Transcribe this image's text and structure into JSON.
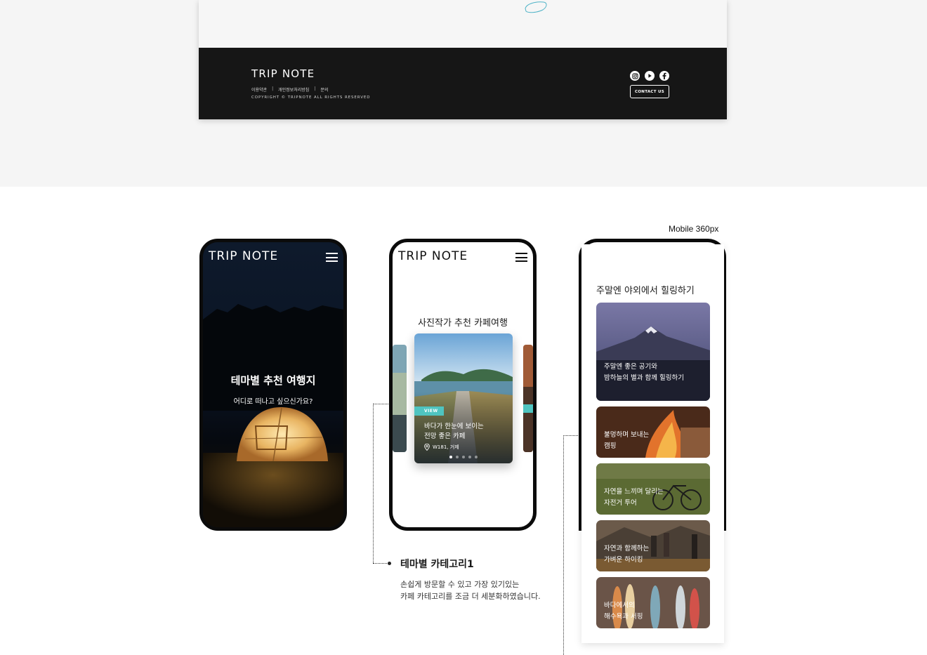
{
  "desktop_footer": {
    "logo": "TRIP NOTE",
    "links": [
      "이용약관",
      "개인정보처리방침",
      "문의"
    ],
    "copyright": "COPYRIGHT © TRIPNOTE ALL RIGHTS RESERVED",
    "social_icons": [
      "instagram-icon",
      "youtube-icon",
      "facebook-icon"
    ],
    "contact_label": "CONTACT US"
  },
  "mobile_label": "Mobile 360px",
  "phone1": {
    "logo": "TRIP NOTE",
    "title": "테마별 추천 여행지",
    "subtitle": "어디로 떠나고 싶으신가요?"
  },
  "phone2": {
    "logo": "TRIP NOTE",
    "section_title": "사진작가 추천 카페여행",
    "card": {
      "badge": "VIEW",
      "title_line1": "바다가 한눈에 보이는",
      "title_line2": "전망 좋은 카페",
      "location": "W181, 거제"
    },
    "page_dots": 5,
    "active_dot": 0
  },
  "phone3": {
    "section_title": "주말엔 야외에서 힐링하기",
    "cards": [
      {
        "line1": "주말엔 좋은 공기와",
        "line2": "밤하늘의 별과 함께 힐링하기"
      },
      {
        "line1": "불멍하며 보내는",
        "line2": "캠핑"
      },
      {
        "line1": "자연을 느끼며 달리는",
        "line2": "자전거 투어"
      },
      {
        "line1": "자연과 함께하는",
        "line2": "가벼운 하이킹"
      },
      {
        "line1": "바다에서의",
        "line2": "해수욕과 서핑"
      }
    ]
  },
  "annotation": {
    "title": "테마별 카테고리1",
    "desc_line1": "손쉽게 방문할 수 있고 가장 있기있는",
    "desc_line2": "카페 카테고리를 조금 더 세분화하였습니다."
  },
  "colors": {
    "footer_bg": "#161616",
    "accent_teal": "#4fc4c0",
    "page_bg_top": "#f5f5f5"
  }
}
